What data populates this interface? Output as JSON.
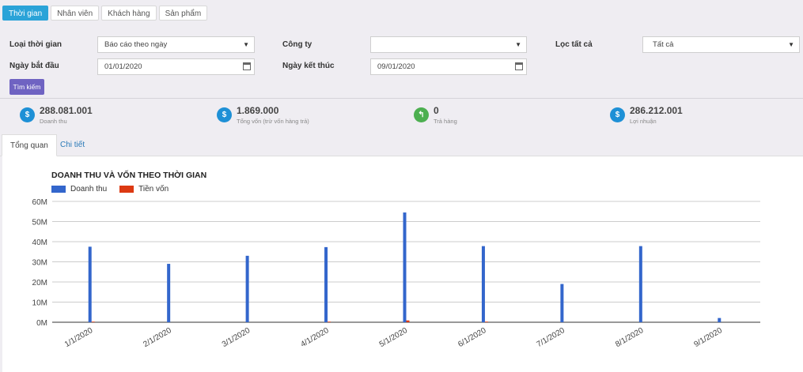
{
  "top_tabs": [
    "Thời gian",
    "Nhân viên",
    "Khách hàng",
    "Sản phẩm"
  ],
  "filters": {
    "time_type_label": "Loại thời gian",
    "time_type_value": "Báo cáo theo ngày",
    "company_label": "Công ty",
    "company_value": "",
    "filter_all_label": "Lọc tất cả",
    "filter_all_value": "Tất cả",
    "start_label": "Ngày bắt đầu",
    "start_value": "01/01/2020",
    "end_label": "Ngày kết thúc",
    "end_value": "09/01/2020",
    "search_button": "Tìm kiếm"
  },
  "summary": [
    {
      "value": "288.081.001",
      "label": "Doanh thu",
      "icon": "dollar-icon",
      "color": "#1e90d6"
    },
    {
      "value": "1.869.000",
      "label": "Tổng vốn (trừ vốn hàng trả)",
      "icon": "dollar-icon",
      "color": "#1e90d6"
    },
    {
      "value": "0",
      "label": "Trả hàng",
      "icon": "return-icon",
      "color": "#4caf50"
    },
    {
      "value": "286.212.001",
      "label": "Lợi nhuận",
      "icon": "dollar-icon",
      "color": "#1e90d6"
    }
  ],
  "view_tabs": [
    "Tổng quan",
    "Chi tiết"
  ],
  "chart_data": {
    "type": "bar",
    "title": "DOANH THU VÀ VỐN THEO THỜI GIAN",
    "categories": [
      "1/1/2020",
      "2/1/2020",
      "3/1/2020",
      "4/1/2020",
      "5/1/2020",
      "6/1/2020",
      "7/1/2020",
      "8/1/2020",
      "9/1/2020"
    ],
    "series": [
      {
        "name": "Doanh thu",
        "color": "#3366cc",
        "values": [
          37500000,
          29000000,
          33000000,
          37300000,
          54500000,
          37800000,
          19000000,
          37800000,
          2100000
        ]
      },
      {
        "name": "Tiền vốn",
        "color": "#dc3912",
        "values": [
          300000,
          0,
          0,
          300000,
          900000,
          300000,
          0,
          0,
          0
        ]
      }
    ],
    "y_ticks": [
      "0M",
      "10M",
      "20M",
      "30M",
      "40M",
      "50M",
      "60M"
    ],
    "ylim": [
      0,
      60000000
    ],
    "grid": true,
    "legend": "top-left"
  }
}
